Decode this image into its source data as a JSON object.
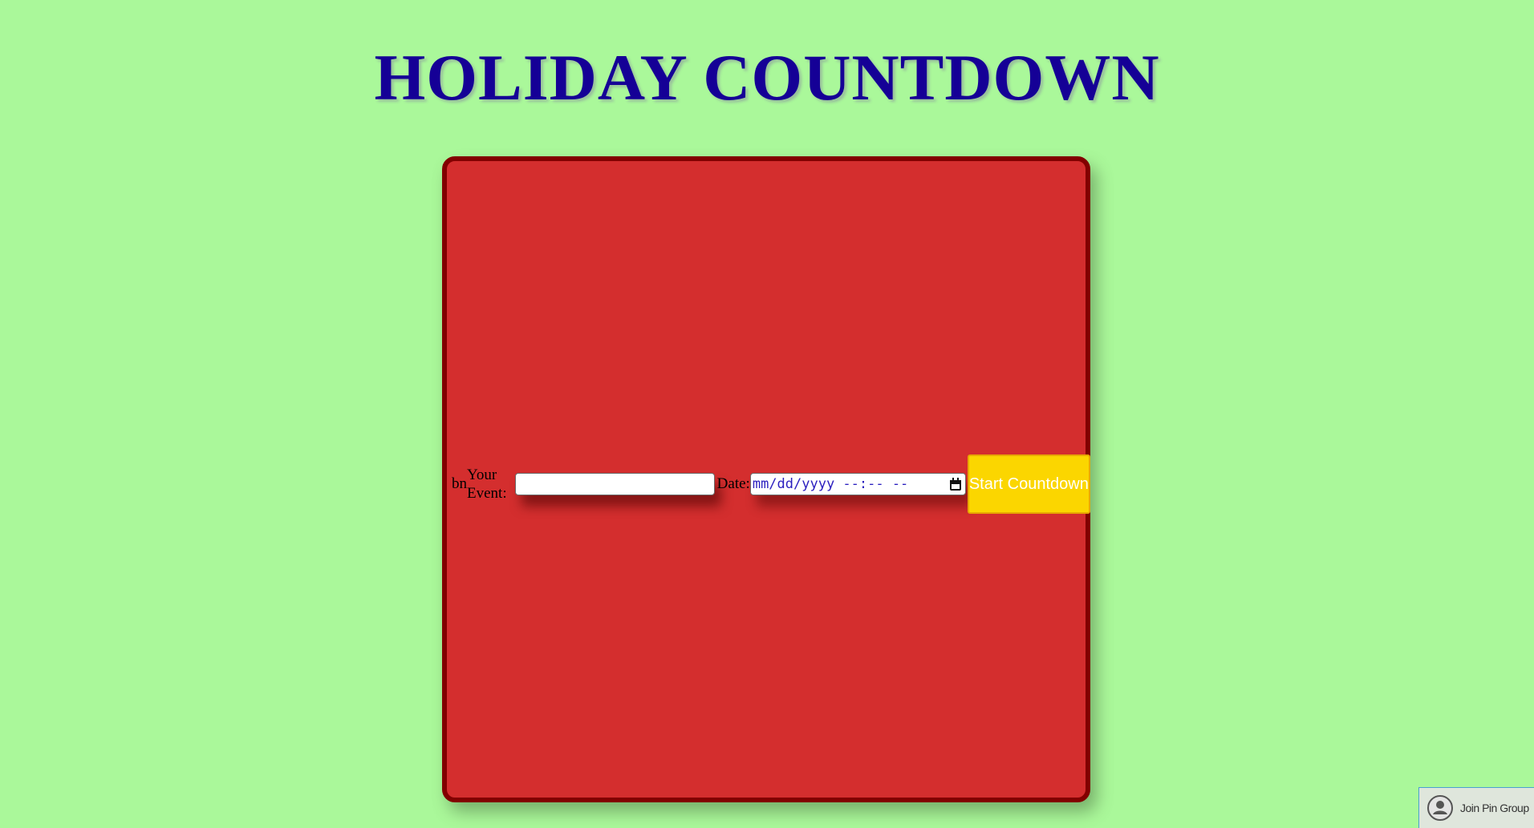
{
  "page": {
    "title": "HOLIDAY COUNTDOWN"
  },
  "form": {
    "stray_text": "bn",
    "event_label": "Your Event:",
    "event_value": "",
    "date_label": "Date:",
    "date_placeholder": "mm/dd/yyyy --:-- --",
    "start_button_label": "Start Countdown"
  },
  "widget": {
    "join_label": "Join Pin Group",
    "icon": "user-circle-icon"
  },
  "colors": {
    "background": "#aaf89a",
    "title": "#150096",
    "card": "#d42e2e",
    "card_border": "#820000",
    "button": "#fbd600"
  }
}
